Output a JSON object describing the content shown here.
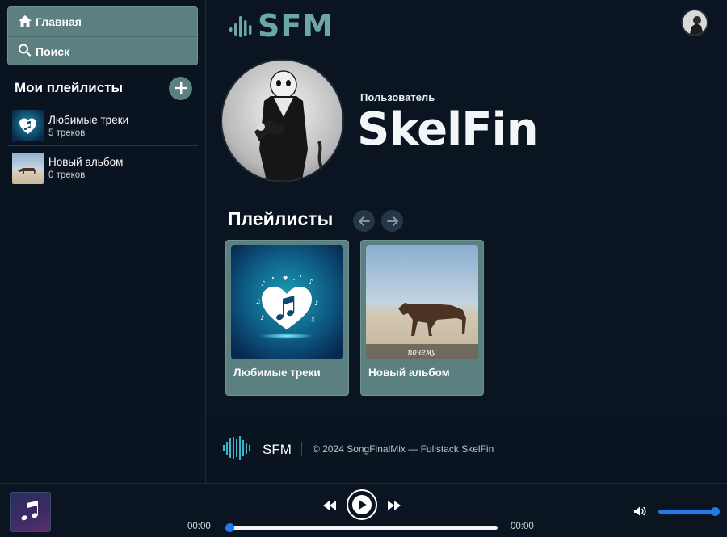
{
  "nav": {
    "home_label": "Главная",
    "search_label": "Поиск"
  },
  "sidebar": {
    "title": "Мои плейлисты",
    "items": [
      {
        "name": "Любимые треки",
        "count": "5 треков"
      },
      {
        "name": "Новый альбом",
        "count": "0 треков"
      }
    ]
  },
  "header": {
    "logo_text": "SFM"
  },
  "profile": {
    "label": "Пользователь",
    "name": "SkelFin"
  },
  "playlists": {
    "title": "Плейлисты",
    "cards": [
      {
        "label": "Любимые треки"
      },
      {
        "label": "Новый альбом",
        "image_caption": "почему"
      }
    ]
  },
  "footer": {
    "brand": "SFM",
    "copyright": "© 2024 SongFinalMix — Fullstack SkelFin"
  },
  "player": {
    "current_time": "00:00",
    "duration": "00:00",
    "progress": 0.0,
    "volume": 0.95
  },
  "colors": {
    "accent": "#5b807f",
    "player_blue": "#1e7be8",
    "logo": "#6aa7a5",
    "background": "#0b1522"
  }
}
